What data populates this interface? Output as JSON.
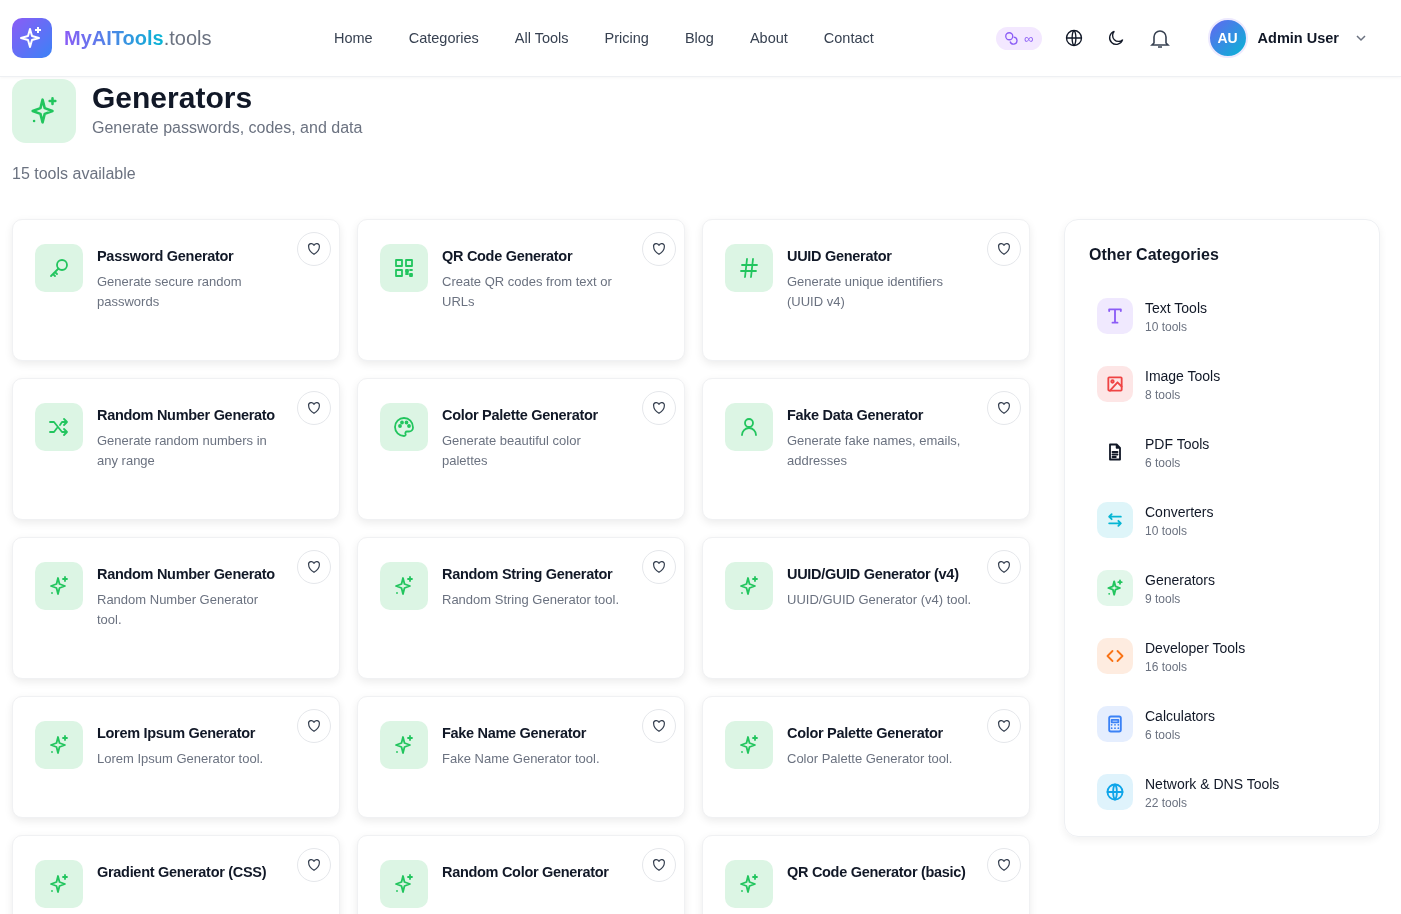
{
  "brand": {
    "name": "MyAITools",
    "suffix": ".tools"
  },
  "nav": [
    "Home",
    "Categories",
    "All Tools",
    "Pricing",
    "Blog",
    "About",
    "Contact"
  ],
  "credits": {
    "value": "∞"
  },
  "user": {
    "initials": "AU",
    "name": "Admin User"
  },
  "category": {
    "title": "Generators",
    "subtitle": "Generate passwords, codes, and data",
    "count": "15 tools available"
  },
  "tools": [
    {
      "kind": "key",
      "title": "Password Generator",
      "description": "Generate secure random passwords"
    },
    {
      "kind": "qr",
      "title": "QR Code Generator",
      "description": "Create QR codes from text or URLs"
    },
    {
      "kind": "hash",
      "title": "UUID Generator",
      "description": "Generate unique identifiers (UUID v4)"
    },
    {
      "kind": "shuffle",
      "title": "Random Number Generato",
      "description": "Generate random numbers in any range"
    },
    {
      "kind": "palette",
      "title": "Color Palette Generator",
      "description": "Generate beautiful color palettes"
    },
    {
      "kind": "user",
      "title": "Fake Data Generator",
      "description": "Generate fake names, emails, addresses"
    },
    {
      "kind": "sparkle",
      "title": "Random Number Generato",
      "description": "Random Number Generator tool."
    },
    {
      "kind": "sparkle",
      "title": "Random String Generator",
      "description": "Random String Generator tool."
    },
    {
      "kind": "sparkle",
      "title": "UUID/GUID Generator (v4)",
      "description": "UUID/GUID Generator (v4) tool."
    },
    {
      "kind": "sparkle",
      "title": "Lorem Ipsum Generator",
      "description": "Lorem Ipsum Generator tool."
    },
    {
      "kind": "sparkle",
      "title": "Fake Name Generator",
      "description": "Fake Name Generator tool."
    },
    {
      "kind": "sparkle",
      "title": "Color Palette Generator",
      "description": "Color Palette Generator tool."
    },
    {
      "kind": "sparkle",
      "title": "Gradient Generator (CSS)"
    },
    {
      "kind": "sparkle",
      "title": "Random Color Generator"
    },
    {
      "kind": "sparkle",
      "title": "QR Code Generator (basic)"
    }
  ],
  "sidebar": {
    "title": "Other Categories",
    "items": [
      {
        "kind": "text",
        "color": "#8b5cf6",
        "name": "Text Tools",
        "count": "10 tools"
      },
      {
        "kind": "image",
        "color": "#ef4444",
        "name": "Image Tools",
        "count": "8 tools"
      },
      {
        "kind": "file",
        "color": "#111827",
        "name": "PDF Tools",
        "count": "6 tools"
      },
      {
        "kind": "arrows",
        "color": "#06b6d4",
        "name": "Converters",
        "count": "10 tools"
      },
      {
        "kind": "sparkle",
        "color": "#22c55e",
        "name": "Generators",
        "count": "9 tools"
      },
      {
        "kind": "code",
        "color": "#f97316",
        "name": "Developer Tools",
        "count": "16 tools"
      },
      {
        "kind": "calculator",
        "color": "#3b82f6",
        "name": "Calculators",
        "count": "6 tools"
      },
      {
        "kind": "globe",
        "color": "#0ea5e9",
        "name": "Network & DNS Tools",
        "count": "22 tools"
      }
    ]
  }
}
